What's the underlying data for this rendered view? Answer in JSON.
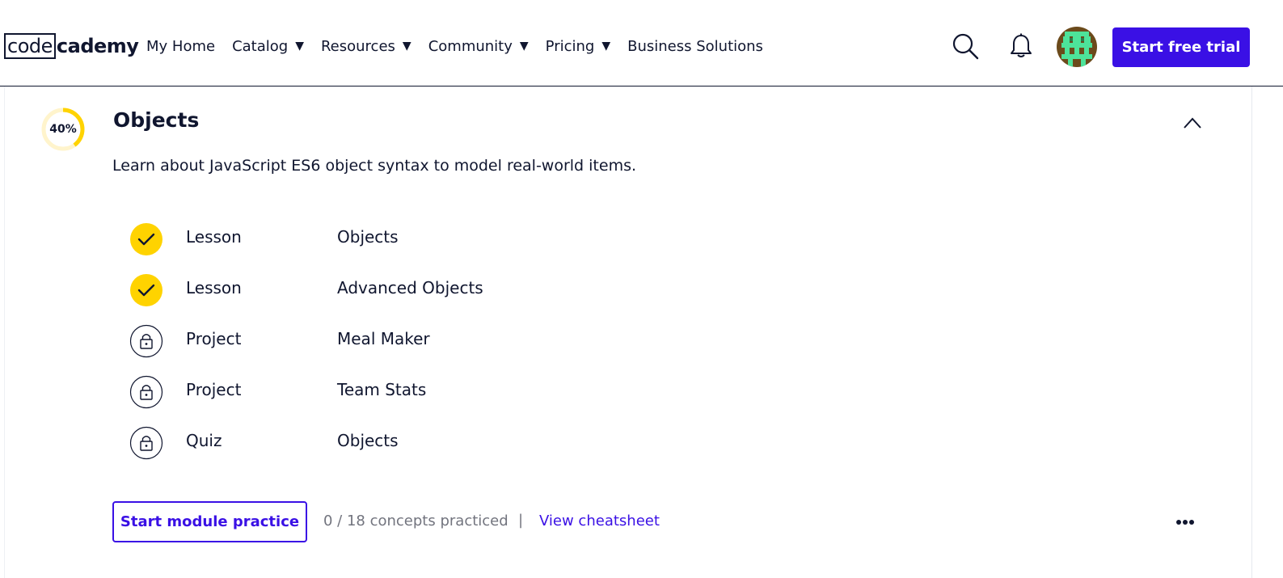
{
  "header": {
    "logo": {
      "part1": "code",
      "part2": "cademy"
    },
    "nav": [
      {
        "label": "My Home",
        "dropdown": false
      },
      {
        "label": "Catalog",
        "dropdown": true
      },
      {
        "label": "Resources",
        "dropdown": true
      },
      {
        "label": "Community",
        "dropdown": true
      },
      {
        "label": "Pricing",
        "dropdown": true
      },
      {
        "label": "Business Solutions",
        "dropdown": false
      }
    ],
    "dropdown_caret": "▼",
    "search_icon": "search-icon",
    "notifications_icon": "bell-icon",
    "avatar_icon": "pixel-avatar",
    "cta_label": "Start free trial"
  },
  "module": {
    "progress_label": "40%",
    "progress_value": 0.4,
    "title": "Objects",
    "description": "Learn about JavaScript ES6 object syntax to model real-world items.",
    "collapse_icon": "chevron-up-icon",
    "items": [
      {
        "type": "Lesson",
        "name": "Objects",
        "status": "completed"
      },
      {
        "type": "Lesson",
        "name": "Advanced Objects",
        "status": "completed"
      },
      {
        "type": "Project",
        "name": "Meal Maker",
        "status": "locked"
      },
      {
        "type": "Project",
        "name": "Team Stats",
        "status": "locked"
      },
      {
        "type": "Quiz",
        "name": "Objects",
        "status": "locked"
      }
    ],
    "practice_button": "Start module practice",
    "practice_count": "0 / 18 concepts practiced",
    "separator": "|",
    "cheatsheet_link": "View cheatsheet",
    "more_icon": "more-horizontal-icon"
  },
  "colors": {
    "brand": "#3a10e5",
    "text": "#10162f",
    "muted": "#72747e",
    "accent_yellow": "#ffd300",
    "progress_track": "#fff4cc"
  }
}
